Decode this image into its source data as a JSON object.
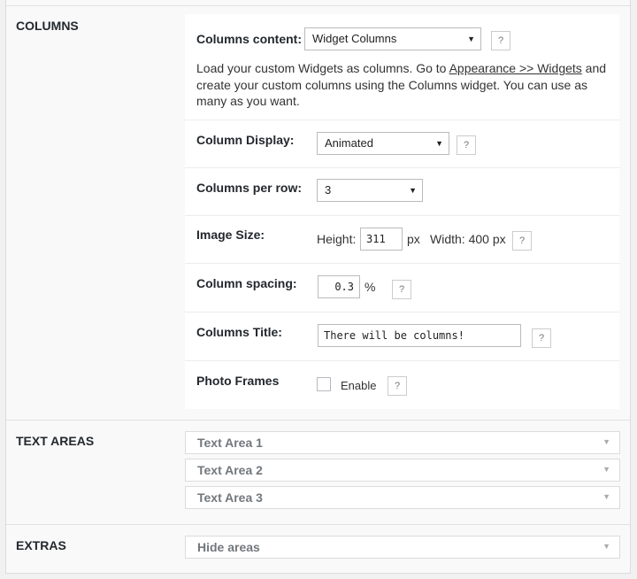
{
  "sections": {
    "columns": "COLUMNS",
    "text_areas": "TEXT AREAS",
    "extras": "EXTRAS"
  },
  "columns_content": {
    "label": "Columns content:",
    "value": "Widget Columns",
    "help": "?",
    "desc_before": "Load your custom Widgets as columns. Go to ",
    "desc_link": "Appearance >> Widgets",
    "desc_after": " and create your custom columns using the Columns widget. You can use as many as you want."
  },
  "column_display": {
    "label": "Column Display:",
    "value": "Animated",
    "help": "?"
  },
  "columns_per_row": {
    "label": "Columns per row:",
    "value": "3"
  },
  "image_size": {
    "label": "Image Size:",
    "height_label": "Height:",
    "height_value": "311",
    "px_unit": "px",
    "width_text": "Width: 400 px",
    "help": "?"
  },
  "column_spacing": {
    "label": "Column spacing:",
    "value": "0.3",
    "unit": "%",
    "help": "?"
  },
  "columns_title": {
    "label": "Columns Title:",
    "value": "There will be columns!",
    "help": "?"
  },
  "photo_frames": {
    "label": "Photo Frames",
    "checked": false,
    "option": "Enable",
    "help": "?"
  },
  "text_areas": [
    "Text Area 1",
    "Text Area 2",
    "Text Area 3"
  ],
  "extras": [
    "Hide areas"
  ],
  "icons": {
    "dropdown": "▼"
  }
}
